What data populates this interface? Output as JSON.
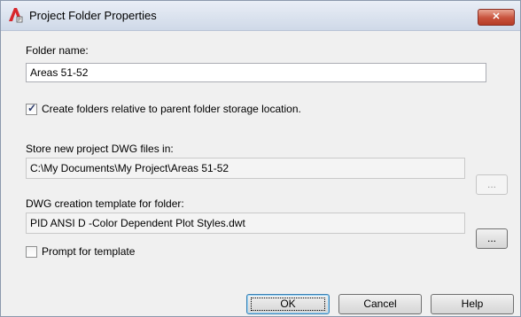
{
  "window": {
    "title": "Project Folder Properties",
    "close_label": "✕"
  },
  "folder_name": {
    "label": "Folder name:",
    "value": "Areas 51-52"
  },
  "relative_option": {
    "checked": true,
    "label": "Create folders relative to parent folder storage location."
  },
  "storage": {
    "label": "Store new project DWG files in:",
    "value": "C:\\My Documents\\My Project\\Areas 51-52",
    "browse_label": "..."
  },
  "template": {
    "label": "DWG creation template for folder:",
    "value": "PID ANSI D -Color Dependent Plot Styles.dwt",
    "browse_label": "..."
  },
  "prompt_option": {
    "checked": false,
    "label": "Prompt for template"
  },
  "buttons": {
    "ok": "OK",
    "cancel": "Cancel",
    "help": "Help"
  },
  "colors": {
    "titlebar": "#cfd9e8",
    "close_button": "#c8523c",
    "dialog_bg": "#f0f0f0"
  },
  "icons": {
    "app": "autocad-app-icon",
    "close": "close-icon",
    "check": "checkmark-icon"
  }
}
